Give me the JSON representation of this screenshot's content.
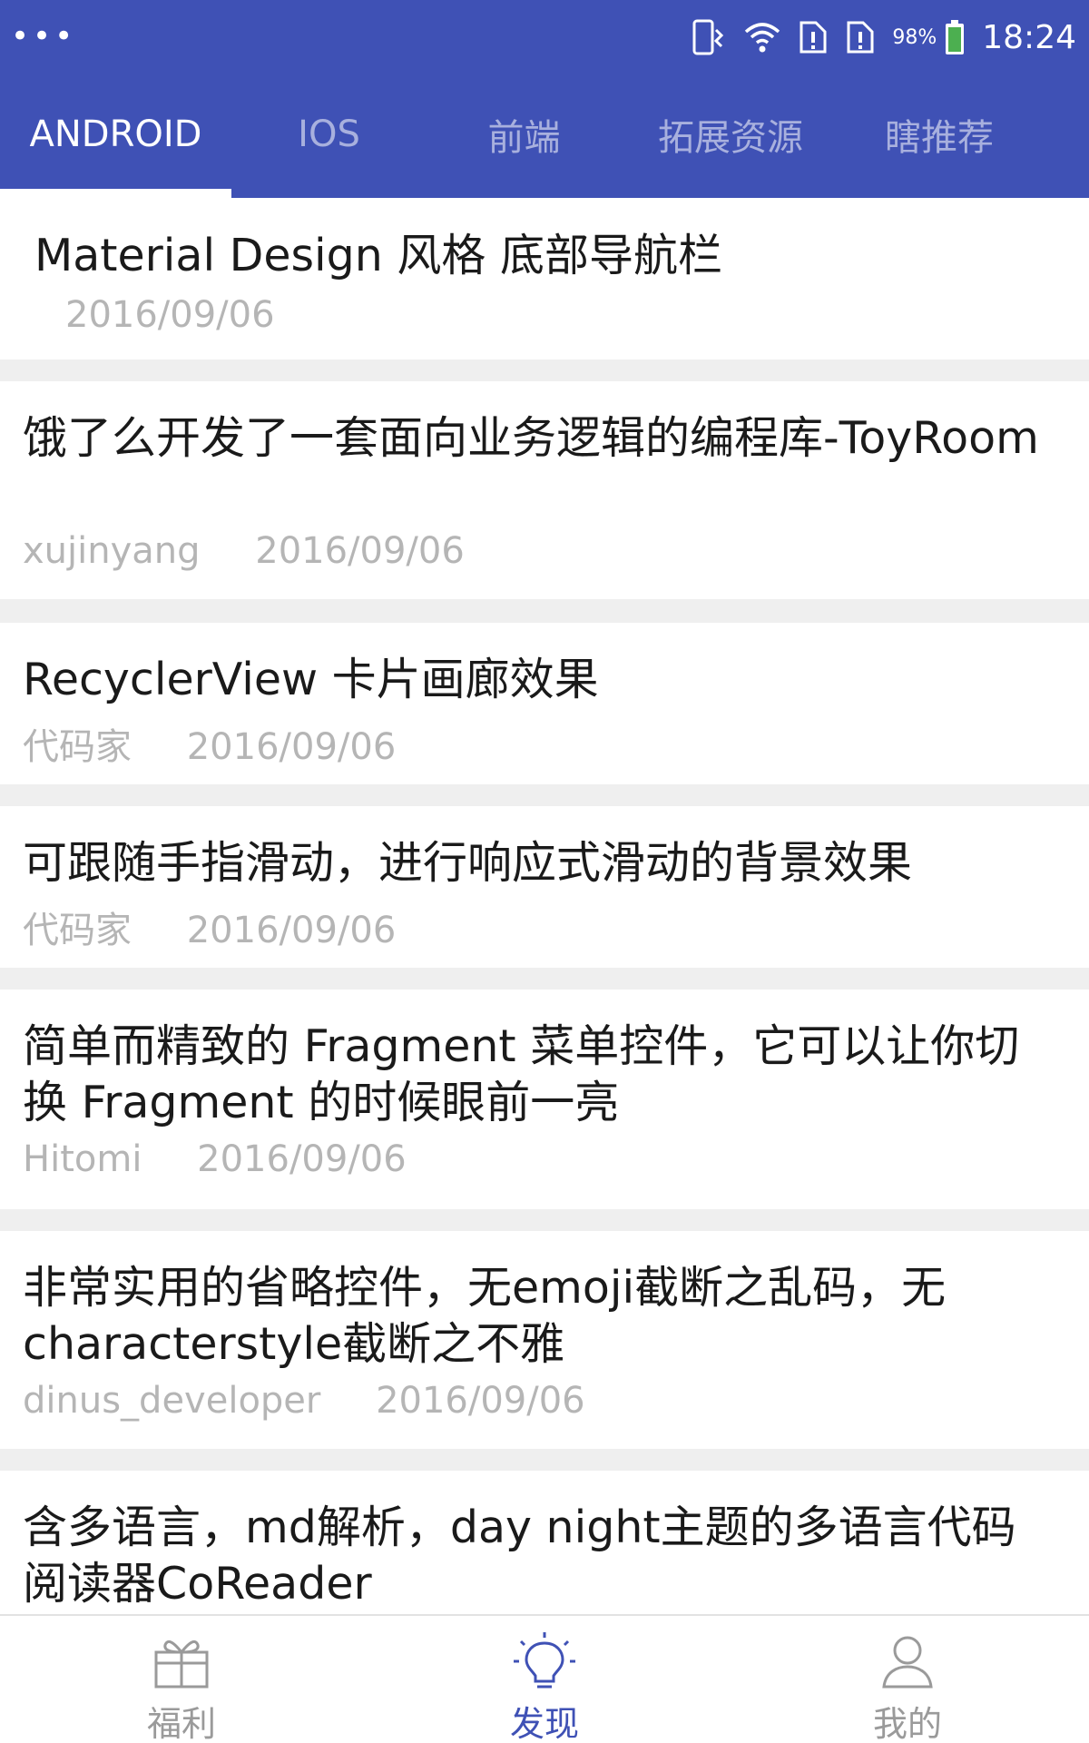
{
  "status_bar": {
    "dots": "•••",
    "battery_percent": "98%",
    "time": "18:24",
    "icons": [
      "vibrate-icon",
      "wifi-icon",
      "sim1-alert-icon",
      "sim2-alert-icon",
      "battery-icon"
    ]
  },
  "tabs": [
    {
      "label": "ANDROID",
      "active": true
    },
    {
      "label": "IOS"
    },
    {
      "label": "前端"
    },
    {
      "label": "拓展资源"
    },
    {
      "label": "瞎推荐"
    }
  ],
  "articles": [
    {
      "title": "Material Design 风格 底部导航栏",
      "author": "",
      "date": "2016/09/06"
    },
    {
      "title": "饿了么开发了一套面向业务逻辑的编程库-ToyRoom",
      "author": "xujinyang",
      "date": "2016/09/06"
    },
    {
      "title": "RecyclerView 卡片画廊效果",
      "author": "代码家",
      "date": "2016/09/06"
    },
    {
      "title": "可跟随手指滑动，进行响应式滑动的背景效果",
      "author": "代码家",
      "date": "2016/09/06"
    },
    {
      "title": "简单而精致的 Fragment 菜单控件，它可以让你切换 Fragment 的时候眼前一亮",
      "author": "Hitomi",
      "date": "2016/09/06"
    },
    {
      "title": "非常实用的省略控件，无emoji截断之乱码，无characterstyle截断之不雅",
      "author": "dinus_developer",
      "date": "2016/09/06"
    },
    {
      "title": "含多语言，md解析，day night主题的多语言代码阅读器CoReader",
      "author": "",
      "date": ""
    }
  ],
  "bottom_nav": [
    {
      "label": "福利",
      "icon": "gift-icon"
    },
    {
      "label": "发现",
      "icon": "lightbulb-icon",
      "active": true
    },
    {
      "label": "我的",
      "icon": "person-icon"
    }
  ],
  "colors": {
    "primary": "#3f51b5",
    "inactive_nav": "#9a9a9a",
    "meta_text": "#b5b5b5",
    "divider": "#efefef"
  }
}
